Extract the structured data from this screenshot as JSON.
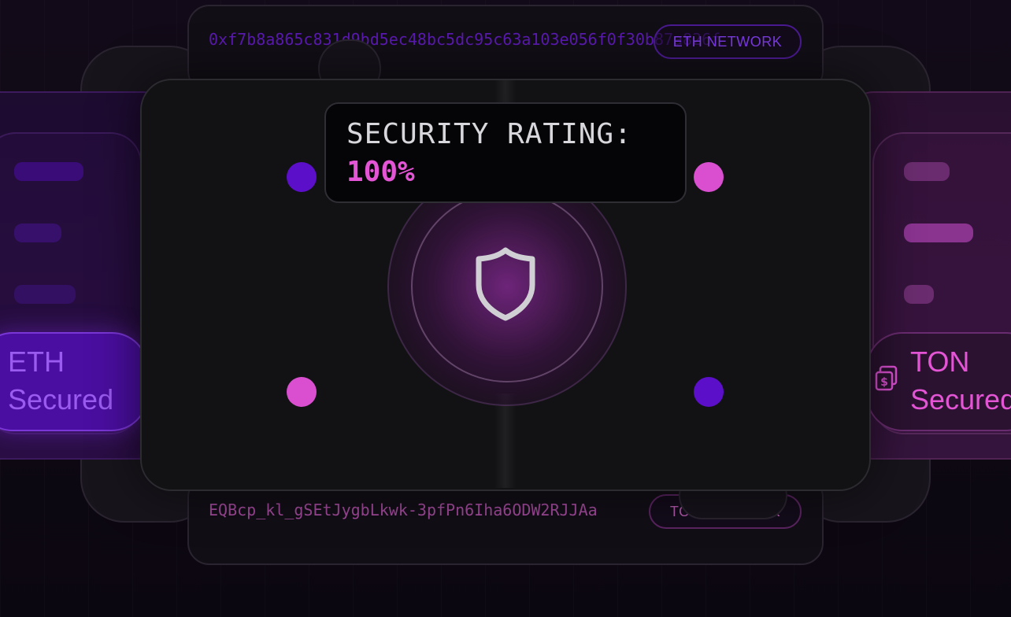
{
  "addresses": {
    "eth": {
      "address": "0xf7b8a865c831d9bd5ec48bc5dc95c63a103e056f0f30b87a826f",
      "network_label": "ETH NETWORK"
    },
    "ton": {
      "address": "EQBcp_kl_gSEtJygbLkwk-3pfPn6Iha6ODW2RJJAa",
      "network_label": "TON NETWORK"
    }
  },
  "security": {
    "label": "SECURITY RATING:",
    "value": "100%",
    "icon": "shield-icon"
  },
  "chains": {
    "eth": {
      "line1": "ETH",
      "line2": "Secured"
    },
    "ton": {
      "line1": "TON",
      "line2": "Secured",
      "icon": "coin-stack-icon"
    }
  },
  "colors": {
    "accent_purple": "#5b0fc9",
    "accent_pink": "#d94fd0",
    "eth_address": "#5a1ab0",
    "ton_address": "#a04a9a"
  }
}
